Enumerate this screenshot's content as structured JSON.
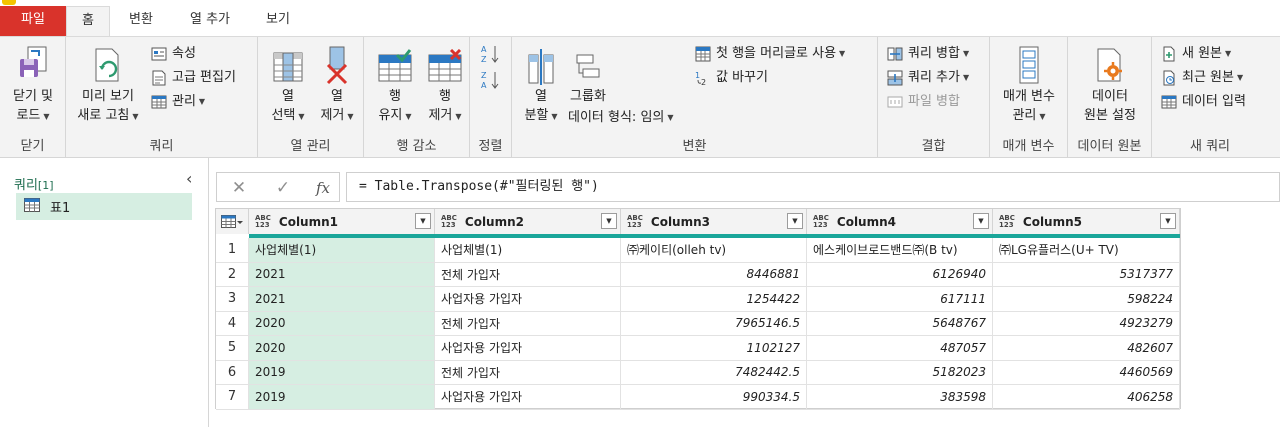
{
  "tabs": [
    "파일",
    "홈",
    "변환",
    "열 추가",
    "보기"
  ],
  "ribbon": {
    "close": {
      "btn": [
        "닫기 및",
        "로드"
      ],
      "label": "닫기"
    },
    "query": {
      "refresh": [
        "미리 보기",
        "새로 고침"
      ],
      "properties": "속성",
      "advanced_editor": "고급 편집기",
      "manage": "관리",
      "label": "쿼리"
    },
    "manage_columns": {
      "choose": [
        "열",
        "선택"
      ],
      "remove": [
        "열",
        "제거"
      ],
      "label": "열 관리"
    },
    "reduce_rows": {
      "keep": [
        "행",
        "유지"
      ],
      "remove": [
        "행",
        "제거"
      ],
      "label": "행 감소"
    },
    "sort": {
      "label": "정렬"
    },
    "transform": {
      "split": [
        "열",
        "분할"
      ],
      "group": "그룹화",
      "first_row_header": "첫 행을 머리글로 사용",
      "replace": "값 바꾸기",
      "data_type": "데이터 형식: 임의",
      "label": "변환"
    },
    "combine": {
      "merge": "쿼리 병합",
      "append": "쿼리 추가",
      "combine_files": "파일 병합",
      "label": "결합"
    },
    "parameters": {
      "manage": [
        "매개 변수",
        "관리"
      ],
      "label": "매개 변수"
    },
    "datasource": {
      "settings": [
        "데이터",
        "원본 설정"
      ],
      "label": "데이터 원본"
    },
    "new_query": {
      "new_source": "새 원본",
      "recent": "최근 원본",
      "enter_data": "데이터 입력",
      "label": "새 쿼리"
    }
  },
  "queries_pane": {
    "title": "쿼리",
    "count": "[1]",
    "items": [
      "표1"
    ]
  },
  "formula_bar": {
    "fx": "fx",
    "formula": "= Table.Transpose(#\"필터링된 행\")"
  },
  "grid": {
    "type_label": [
      "ABC",
      "123"
    ],
    "columns": [
      "Column1",
      "Column2",
      "Column3",
      "Column4",
      "Column5"
    ],
    "rows": [
      [
        "1",
        "사업체별(1)",
        "사업체별(1)",
        "㈜케이티(olleh tv)",
        "에스케이브로드밴드㈜(B tv)",
        "㈜LG유플러스(U+ TV)"
      ],
      [
        "2",
        "2021",
        "전체 가입자",
        "8446881",
        "6126940",
        "5317377"
      ],
      [
        "3",
        "2021",
        "사업자용 가입자",
        "1254422",
        "617111",
        "598224"
      ],
      [
        "4",
        "2020",
        "전체 가입자",
        "7965146.5",
        "5648767",
        "4923279"
      ],
      [
        "5",
        "2020",
        "사업자용 가입자",
        "1102127",
        "487057",
        "482607"
      ],
      [
        "6",
        "2019",
        "전체 가입자",
        "7482442.5",
        "5182023",
        "4460569"
      ],
      [
        "7",
        "2019",
        "사업자용 가입자",
        "990334.5",
        "383598",
        "406258"
      ]
    ]
  },
  "colors": {
    "file_tab": "#d9332b",
    "accent_teal": "#1aa69a",
    "selected": "#d6eee2"
  }
}
